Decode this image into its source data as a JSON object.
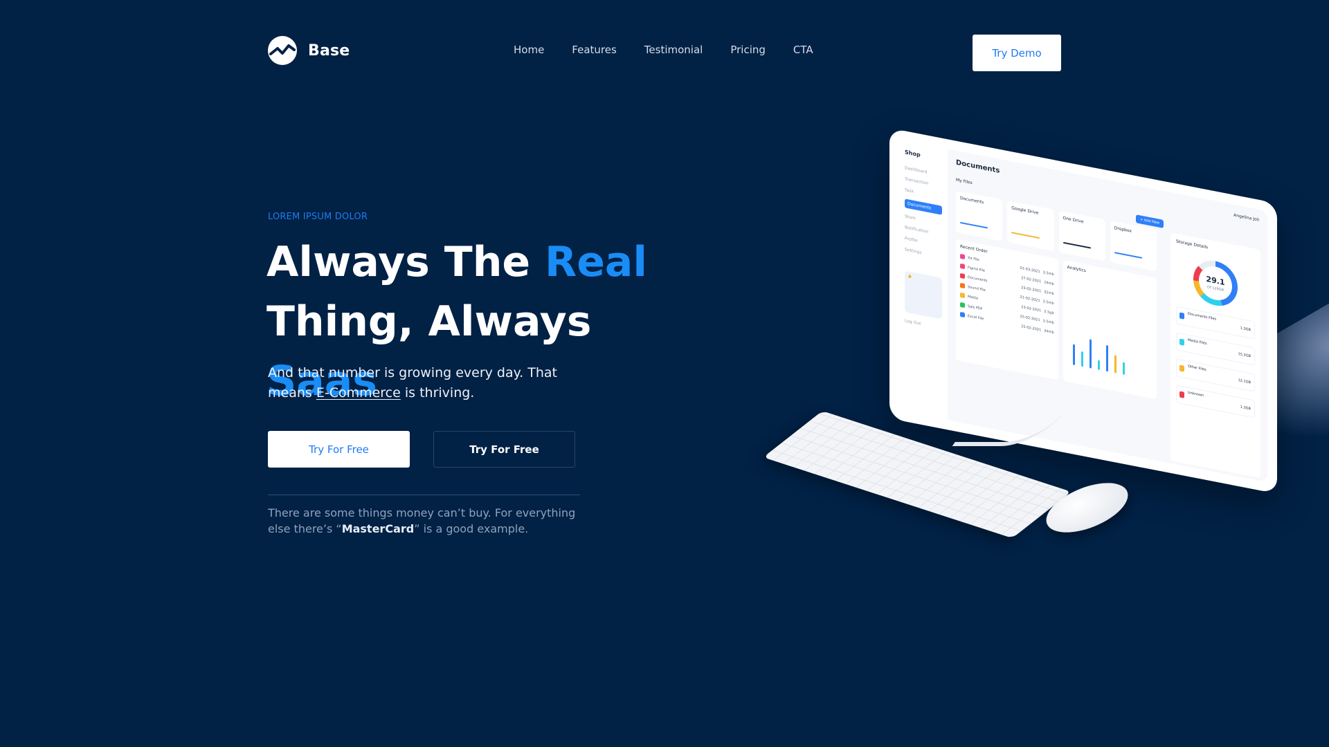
{
  "brand": {
    "name": "Base"
  },
  "nav": {
    "items": [
      "Home",
      "Features",
      "Testimonial",
      "Pricing",
      "CTA"
    ],
    "cta": "Try Demo"
  },
  "hero": {
    "eyebrow": "LOREM IPSUM DOLOR",
    "line1_prefix": "Always The ",
    "line1_accent": "Real",
    "line2_prefix": "Thing, Always ",
    "line2_accent": "Saas",
    "lead_before": "And that number is growing every day. That means ",
    "lead_link": "E-Commerce",
    "lead_after": " is thriving.",
    "primary_button": "Try For Free",
    "secondary_button": "Try For Free",
    "quote_before": "There are some things money can’t buy. For everything else there’s “",
    "quote_bold": "MasterCard",
    "quote_after": "” is a good example."
  },
  "dashboard": {
    "brand": "Shop",
    "sidebar": [
      "Dashboard",
      "Transaction",
      "Task",
      "Documents",
      "Store",
      "Notification",
      "Profile",
      "Settings"
    ],
    "logout": "Log Out",
    "title": "Documents",
    "my_files": "My Files",
    "search_placeholder": "Search",
    "user": "Angelina Joli",
    "add_new": "+ Add New",
    "cards": [
      "Documents",
      "Google Drive",
      "One Drive",
      "Dropbox"
    ],
    "recent_order": "Recent Order",
    "orders": [
      {
        "name": "Xd File",
        "date": "01-03-2021",
        "size": "3.5mb"
      },
      {
        "name": "Figma File",
        "date": "27-02-2021",
        "size": "19mb"
      },
      {
        "name": "Documents",
        "date": "23-02-2021",
        "size": "32mb"
      },
      {
        "name": "Sound File",
        "date": "21-02-2021",
        "size": "3.5mb"
      },
      {
        "name": "Media",
        "date": "23-02-2021",
        "size": "2.5gb"
      },
      {
        "name": "Sals PDF",
        "date": "25-02-2021",
        "size": "3.5mb"
      },
      {
        "name": "Excel File",
        "date": "25-02-2021",
        "size": "34mb"
      }
    ],
    "analytics": "Analytics",
    "storage_title": "Storage Details",
    "storage_value": "29.1",
    "storage_of": "Of 128GB",
    "storage_files": [
      {
        "name": "Documents Files",
        "size": "1.3GB"
      },
      {
        "name": "Media Files",
        "size": "15.3GB"
      },
      {
        "name": "Other Files",
        "size": "12.1GB"
      },
      {
        "name": "Unknown",
        "size": "1.3GB"
      }
    ]
  },
  "colors": {
    "background": "#012145",
    "accent": "#1a8cf6",
    "link": "#1f7bf2"
  }
}
